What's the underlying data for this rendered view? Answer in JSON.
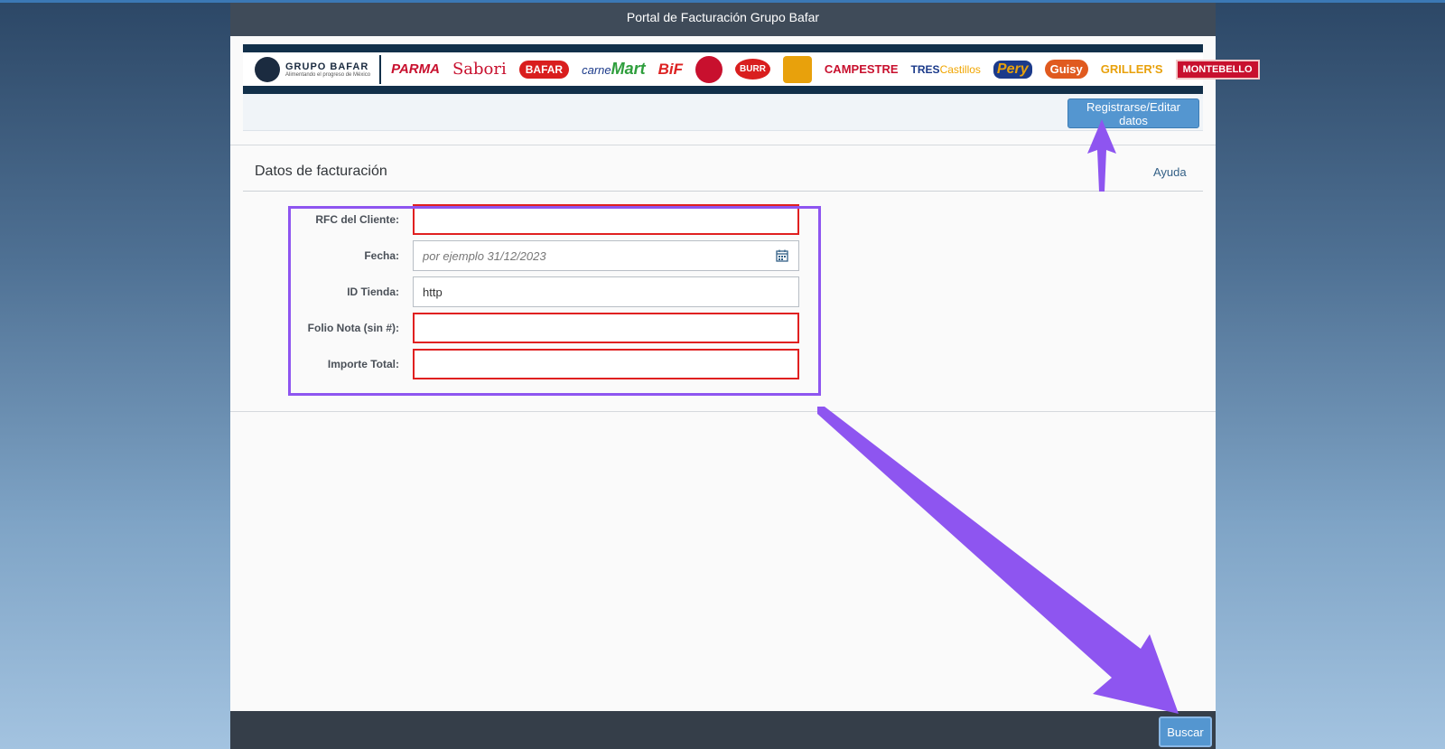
{
  "window": {
    "title": "Portal de Facturación Grupo Bafar"
  },
  "brands": {
    "main_name": "GRUPO BAFAR",
    "main_tagline": "Alimentando el progreso de México",
    "parma": "PARMA",
    "sabori": "Sabori",
    "bafar": "BAFAR",
    "carnemart_a": "carne",
    "carnemart_b": "Mart",
    "bif": "BiF",
    "burr": "BURR",
    "campestre": "CAMPESTRE",
    "tres_a": "TRES",
    "tres_b": "Castillos",
    "pery": "Pery",
    "guisy": "Guisy",
    "grillers": "GRILLER'S",
    "montebello": "MONTEBELLO"
  },
  "toolbar": {
    "register_label": "Registrarse/Editar datos"
  },
  "section": {
    "title": "Datos de facturación",
    "help_label": "Ayuda"
  },
  "form": {
    "rfc": {
      "label": "RFC del Cliente:",
      "value": ""
    },
    "fecha": {
      "label": "Fecha:",
      "placeholder": "por ejemplo 31/12/2023",
      "value": ""
    },
    "id_tienda": {
      "label": "ID Tienda:",
      "value": "http"
    },
    "folio": {
      "label": "Folio Nota (sin #):",
      "value": ""
    },
    "importe": {
      "label": "Importe Total:",
      "value": ""
    }
  },
  "footer": {
    "search_label": "Buscar"
  },
  "colors": {
    "accent": "#5496d0",
    "error": "#e02020",
    "annotation": "#8e55f0"
  }
}
